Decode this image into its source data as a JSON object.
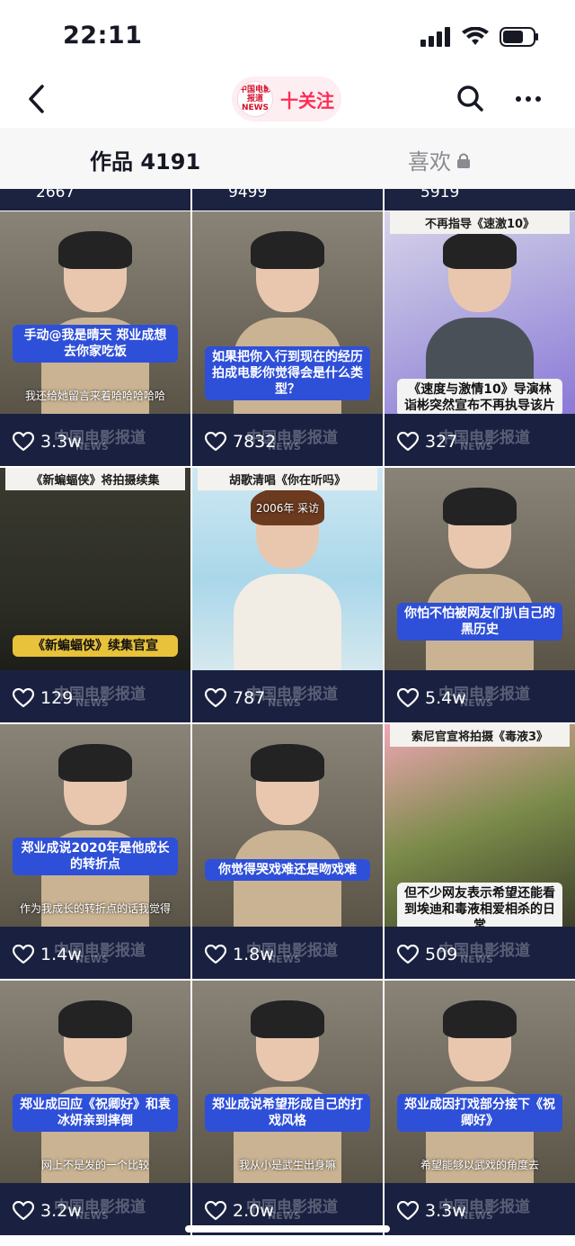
{
  "status_bar": {
    "time": "22:11"
  },
  "nav": {
    "account_logo_text": "中国电影报道 NEWS",
    "follow_label": "十关注"
  },
  "tabs": {
    "works_label": "作品 4191",
    "likes_label": "喜欢"
  },
  "partial_row_counts": [
    "2667",
    "9499",
    "5919"
  ],
  "grid": [
    {
      "likes": "3.3w",
      "caption": "手动@我是晴天 郑业成想去你家吃饭",
      "subtitle": "我还给她留言来着哈哈哈哈哈",
      "theme": "interview"
    },
    {
      "likes": "7832",
      "caption": "如果把你入行到现在的经历拍成电影你觉得会是什么类型？",
      "subtitle": "",
      "theme": "interview"
    },
    {
      "likes": "327",
      "top_title": "不再指导《速激10》",
      "caption": "《速度与激情10》导演林诣彬突然宣布不再执导该片",
      "subtitle": "",
      "theme": "director"
    },
    {
      "likes": "129",
      "top_title": "《新蝙蝠侠》将拍摄续集",
      "caption": "《新蝙蝠侠》续集官宣",
      "subtitle": "",
      "theme": "batman"
    },
    {
      "likes": "787",
      "top_title": "胡歌清唱《你在听吗》",
      "caption": "",
      "subtitle": "2006年 采访",
      "theme": "singer"
    },
    {
      "likes": "5.4w",
      "caption": "你怕不怕被网友们扒自己的黑历史",
      "subtitle": "",
      "theme": "interview"
    },
    {
      "likes": "1.4w",
      "caption": "郑业成说2020年是他成长的转折点",
      "subtitle": "作为我成长的转折点的话我觉得",
      "theme": "interview"
    },
    {
      "likes": "1.8w",
      "caption": "你觉得哭戏难还是吻戏难",
      "subtitle": "",
      "theme": "interview"
    },
    {
      "likes": "509",
      "top_title": "索尼官宣将拍摄《毒液3》",
      "caption": "但不少网友表示希望还能看到埃迪和毒液相爱相杀的日常",
      "subtitle": "",
      "theme": "venom"
    },
    {
      "likes": "3.2w",
      "caption": "郑业成回应《祝卿好》和袁冰妍亲到摔倒",
      "subtitle": "网上不是发的一个比较",
      "theme": "interview"
    },
    {
      "likes": "2.0w",
      "caption": "郑业成说希望形成自己的打戏风格",
      "subtitle": "我从小是武生出身嘛",
      "theme": "interview"
    },
    {
      "likes": "3.3w",
      "caption": "郑业成因打戏部分接下《祝卿好》",
      "subtitle": "希望能够以武戏的角度去",
      "theme": "interview"
    }
  ],
  "watermark": {
    "text": "中国电影报道",
    "badge": "NEWS"
  },
  "colors": {
    "accent": "#fe2c55",
    "caption_blue": "#2e4fd8",
    "tile_footer": "#1a2140"
  }
}
